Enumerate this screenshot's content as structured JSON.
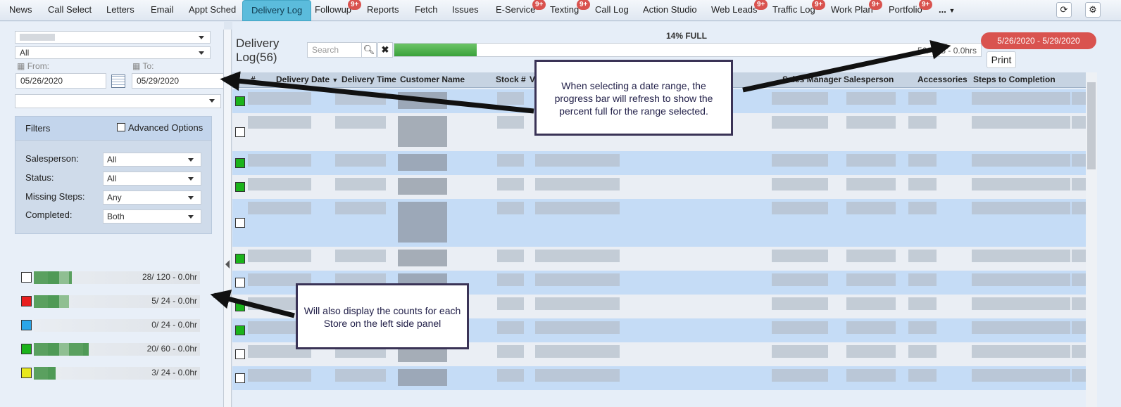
{
  "nav": {
    "tabs": [
      {
        "label": "News"
      },
      {
        "label": "Call Select"
      },
      {
        "label": "Letters"
      },
      {
        "label": "Email"
      },
      {
        "label": "Appt Sched"
      },
      {
        "label": "Delivery Log",
        "active": true
      },
      {
        "label": "Followup",
        "badge": "9+"
      },
      {
        "label": "Reports"
      },
      {
        "label": "Fetch"
      },
      {
        "label": "Issues"
      },
      {
        "label": "E-Service",
        "badge": "9+"
      },
      {
        "label": "Texting",
        "badge": "9+"
      },
      {
        "label": "Call Log"
      },
      {
        "label": "Action Studio"
      },
      {
        "label": "Web Leads",
        "badge": "9+"
      },
      {
        "label": "Traffic Log",
        "badge": "9+"
      },
      {
        "label": "Work Plan",
        "badge": "9+"
      },
      {
        "label": "Portfolio",
        "badge": "9+"
      },
      {
        "label": "..."
      }
    ],
    "icons": {
      "refresh": "refresh-icon",
      "settings": "gear-icon"
    }
  },
  "left": {
    "store_select": "",
    "type_select": "All",
    "from_label": "From:",
    "to_label": "To:",
    "from_value": "05/26/2020",
    "to_value": "05/29/2020",
    "third_select": "",
    "filters": {
      "title": "Filters",
      "advanced_label": "Advanced Options",
      "rows": [
        {
          "label": "Salesperson:",
          "value": "All"
        },
        {
          "label": "Status:",
          "value": "All"
        },
        {
          "label": "Missing Steps:",
          "value": "Any"
        },
        {
          "label": "Completed:",
          "value": "Both"
        }
      ]
    },
    "stores": [
      {
        "color": "#ffffff",
        "text": "28/ 120 - 0.0hr",
        "fill": 0.23
      },
      {
        "color": "#e81e1e",
        "text": "5/ 24 - 0.0hr",
        "fill": 0.21
      },
      {
        "color": "#2aa6e8",
        "text": "0/ 24 - 0.0hr",
        "fill": 0
      },
      {
        "color": "#1bb31b",
        "text": "20/ 60 - 0.0hr",
        "fill": 0.33
      },
      {
        "color": "#e8e81e",
        "text": "3/ 24 - 0.0hr",
        "fill": 0.13
      }
    ]
  },
  "main": {
    "title": "Delivery Log(56)",
    "search_placeholder": "Search",
    "progress_label": "14% FULL",
    "progress_value": 0.14,
    "progress_hrs": "56/ 393 - 0.0hrs",
    "date_range": "5/26/2020 - 5/29/2020",
    "print_label": "Print",
    "columns": [
      "#",
      "Delivery Date",
      "Delivery Time",
      "Customer Name",
      "Stock #",
      "V",
      "Sales Manager",
      "Salesperson",
      "Accessories",
      "Steps to Completion"
    ],
    "row_checks": [
      "green",
      "white",
      "green",
      "green",
      "white",
      "green",
      "white",
      "green",
      "green",
      "white",
      "white"
    ]
  },
  "callouts": {
    "date_note": "When selecting a date range, the progress bar will refresh to show the percent full for the range selected.",
    "store_note": "Will also display the counts for each Store on the left side panel"
  }
}
